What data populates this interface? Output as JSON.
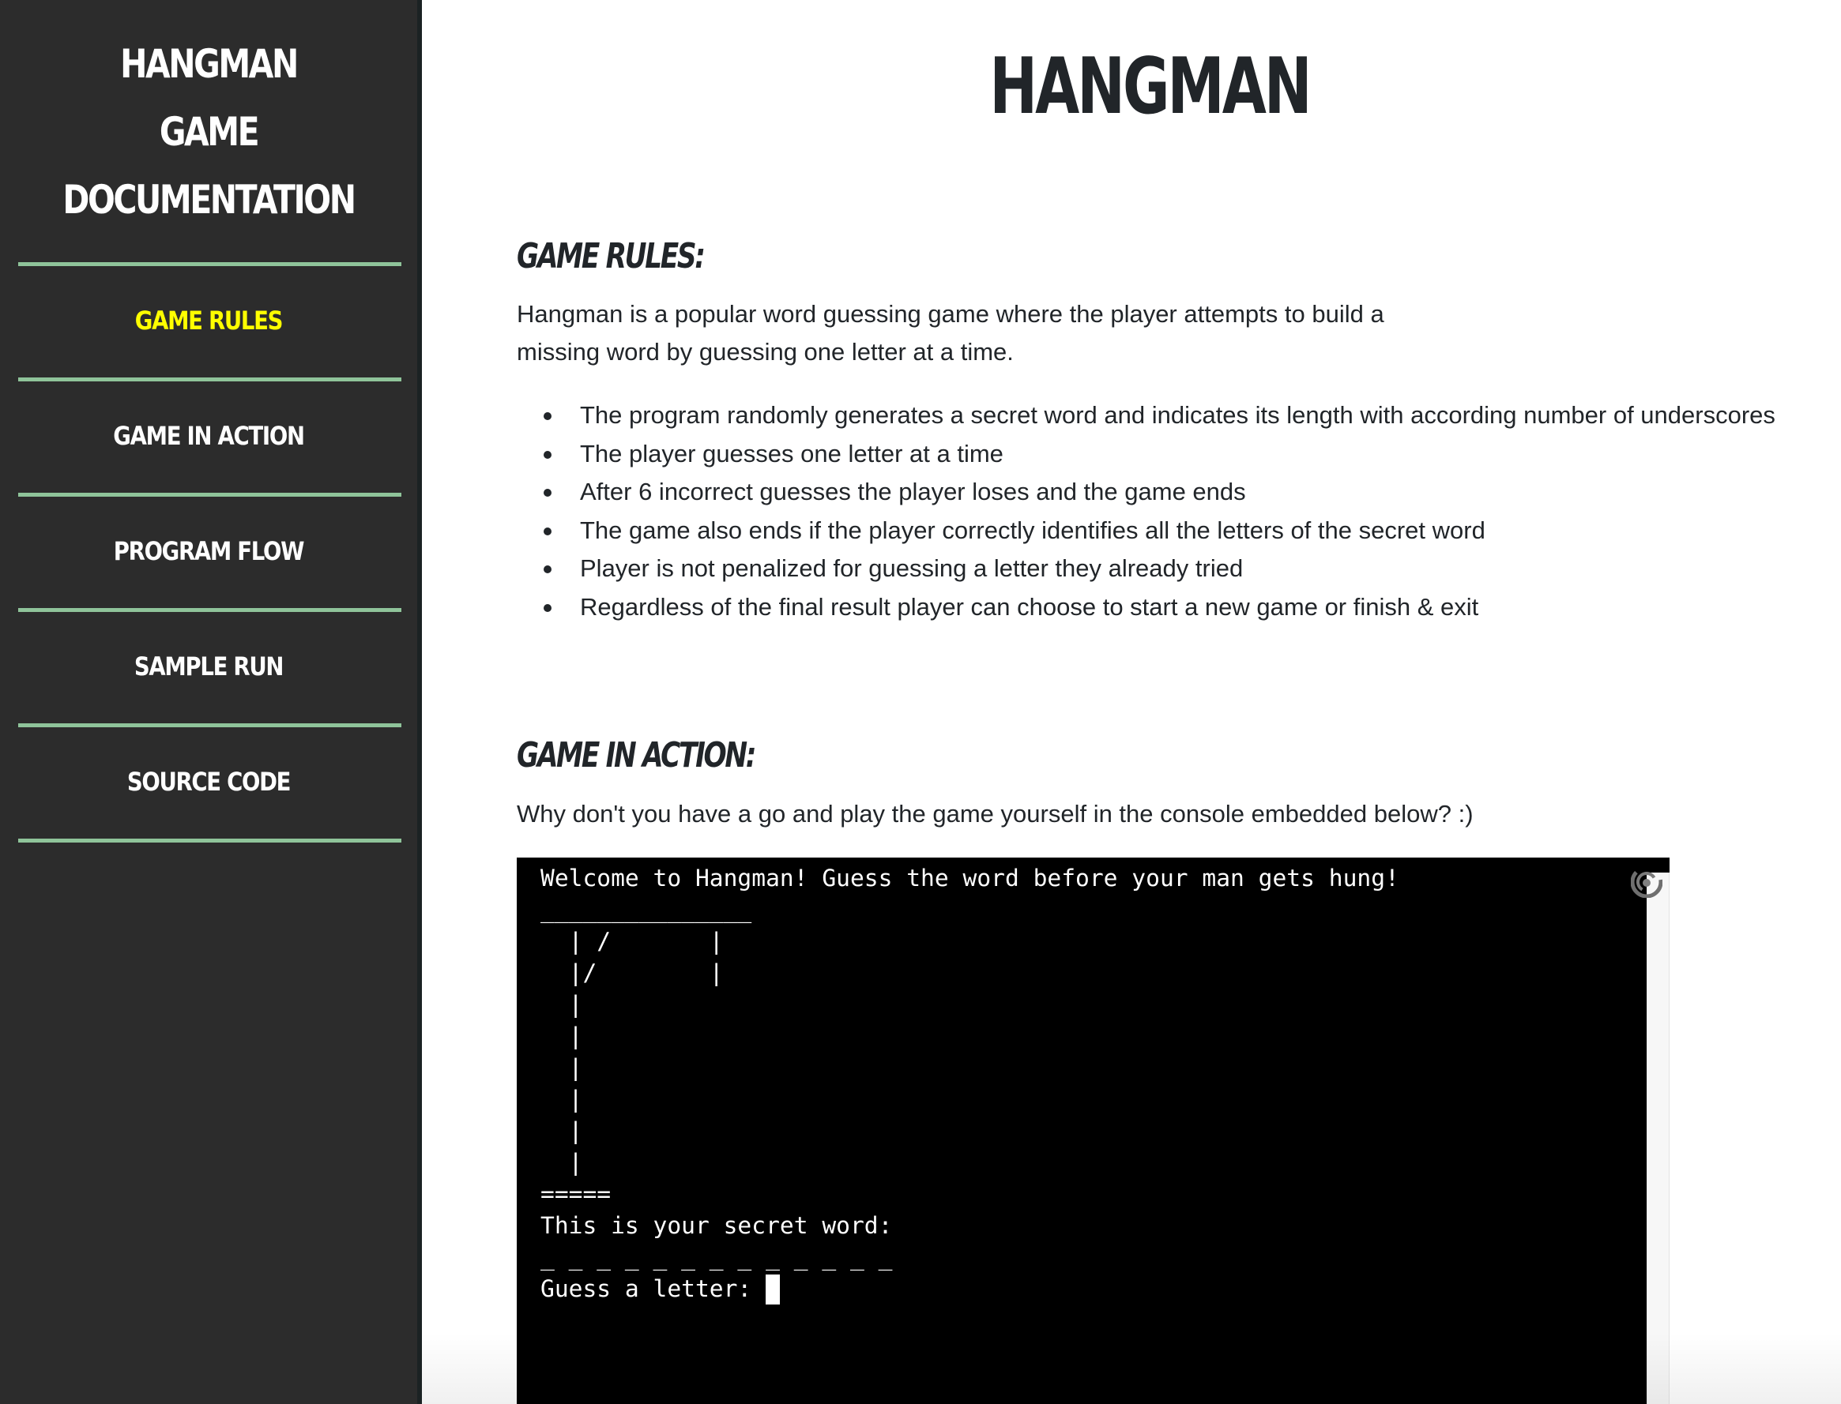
{
  "sidebar": {
    "title_lines": [
      "HANGMAN",
      "GAME",
      "DOCUMENTATION"
    ],
    "items": [
      {
        "label": "GAME RULES",
        "active": true
      },
      {
        "label": "GAME IN ACTION",
        "active": false
      },
      {
        "label": "PROGRAM FLOW",
        "active": false
      },
      {
        "label": "SAMPLE RUN",
        "active": false
      },
      {
        "label": "SOURCE CODE",
        "active": false
      }
    ],
    "colors": {
      "background": "#2c2c2c",
      "separator": "#8fc49a",
      "active_text": "#ffff00",
      "text": "#ffffff"
    }
  },
  "main": {
    "title": "HANGMAN",
    "sections": {
      "rules": {
        "heading": "GAME RULES:",
        "intro": "Hangman is a popular word guessing game where the player attempts to build a missing word by guessing one letter at a time.",
        "bullets": [
          "The program randomly generates a secret word and indicates its length with according number of underscores",
          "The player guesses one letter at a time",
          "After 6 incorrect guesses the player loses and the game ends",
          "The game also ends if the player correctly identifies all the letters of the secret word",
          "Player is not penalized for guessing a letter they already tried",
          "Regardless of the final result player can choose to start a new game or finish & exit"
        ]
      },
      "action": {
        "heading": "GAME IN ACTION:",
        "intro": "Why don't you have a go and play the game yourself in the console embedded below? :)"
      }
    }
  },
  "console": {
    "lines": [
      "Welcome to Hangman! Guess the word before your man gets hung!",
      "_______________",
      "  | /       |",
      "  |/        |",
      "  |",
      "  |",
      "  |",
      "  |",
      "  |",
      "  |",
      "=====",
      "This is your secret word:",
      "_ _ _ _ _ _ _ _ _ _ _ _ _"
    ],
    "prompt": "Guess a letter: ",
    "icon": "swirl-icon",
    "colors": {
      "background": "#000000",
      "text": "#ffffff"
    }
  }
}
